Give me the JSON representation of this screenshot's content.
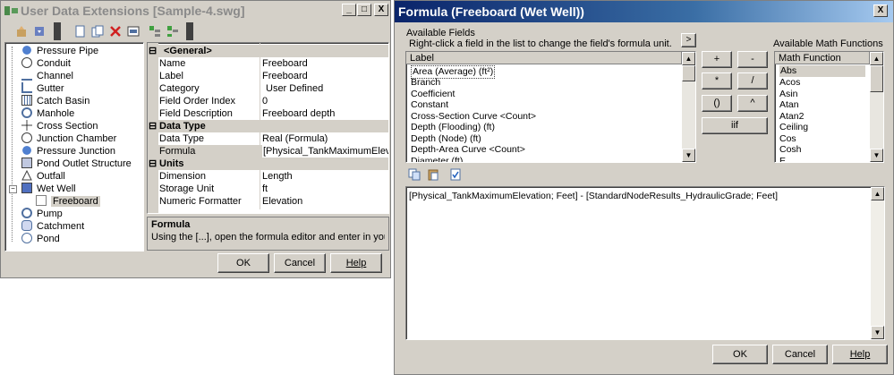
{
  "left_window": {
    "title": "User Data Extensions [Sample-4.swg]",
    "sys_buttons": [
      "_",
      "□",
      "X"
    ],
    "tree": [
      {
        "label": "Pressure Pipe",
        "icon": "pressure-pipe-icon"
      },
      {
        "label": "Conduit",
        "icon": "conduit-icon"
      },
      {
        "label": "Channel",
        "icon": "channel-icon"
      },
      {
        "label": "Gutter",
        "icon": "gutter-icon"
      },
      {
        "label": "Catch Basin",
        "icon": "catch-basin-icon"
      },
      {
        "label": "Manhole",
        "icon": "manhole-icon"
      },
      {
        "label": "Cross Section",
        "icon": "cross-section-icon"
      },
      {
        "label": "Junction Chamber",
        "icon": "junction-chamber-icon"
      },
      {
        "label": "Pressure Junction",
        "icon": "pressure-junction-icon"
      },
      {
        "label": "Pond Outlet Structure",
        "icon": "pond-outlet-icon"
      },
      {
        "label": "Outfall",
        "icon": "outfall-icon"
      },
      {
        "label": "Wet Well",
        "icon": "wet-well-icon"
      },
      {
        "label": "Freeboard",
        "icon": "field-icon"
      },
      {
        "label": "Pump",
        "icon": "pump-icon"
      },
      {
        "label": "Catchment",
        "icon": "catchment-icon"
      },
      {
        "label": "Pond",
        "icon": "pond-icon"
      }
    ],
    "props": {
      "general": {
        "label": "<General>",
        "rows": [
          {
            "name": "Name",
            "value": "Freeboard"
          },
          {
            "name": "Label",
            "value": "Freeboard"
          },
          {
            "name": "Category",
            "value": "User Defined"
          },
          {
            "name": "Field Order Index",
            "value": "0"
          },
          {
            "name": "Field Description",
            "value": "Freeboard depth"
          }
        ]
      },
      "data_type": {
        "label": "Data Type",
        "rows": [
          {
            "name": "Data Type",
            "value": "Real (Formula)"
          },
          {
            "name": "Formula",
            "value": "[Physical_TankMaximumElevation"
          }
        ]
      },
      "units": {
        "label": "Units",
        "rows": [
          {
            "name": "Dimension",
            "value": "Length"
          },
          {
            "name": "Storage Unit",
            "value": "ft"
          },
          {
            "name": "Numeric Formatter",
            "value": "Elevation"
          }
        ]
      },
      "collapse_glyph": "⊟"
    },
    "help": {
      "title": "Formula",
      "text": "Using the [...], open the formula editor and enter in your for..."
    },
    "buttons": {
      "ok": "OK",
      "cancel": "Cancel",
      "help": "Help"
    }
  },
  "right_window": {
    "title": "Formula (Freeboard (Wet Well))",
    "close_label": "X",
    "available_fields_label": "Available Fields",
    "hint": "Right-click a field in the list to change the field's formula unit.",
    "insert_button": ">",
    "fields_header": "Label",
    "fields": [
      "Area (Average) (ft²)",
      "Branch",
      "Coefficient",
      "Constant",
      "Cross-Section Curve <Count>",
      "Depth (Flooding) (ft)",
      "Depth (Node) (ft)",
      "Depth-Area Curve <Count>",
      "Diameter (ft)"
    ],
    "operators": [
      "+",
      "-",
      "*",
      "/",
      "()",
      "^",
      "iif"
    ],
    "math_label": "Available Math Functions",
    "math_header": "Math Function",
    "math_functions": [
      "Abs",
      "Acos",
      "Asin",
      "Atan",
      "Atan2",
      "Ceiling",
      "Cos",
      "Cosh",
      "E"
    ],
    "formula": "[Physical_TankMaximumElevation; Feet] - [StandardNodeResults_HydraulicGrade; Feet]",
    "buttons": {
      "ok": "OK",
      "cancel": "Cancel",
      "help": "Help"
    }
  }
}
